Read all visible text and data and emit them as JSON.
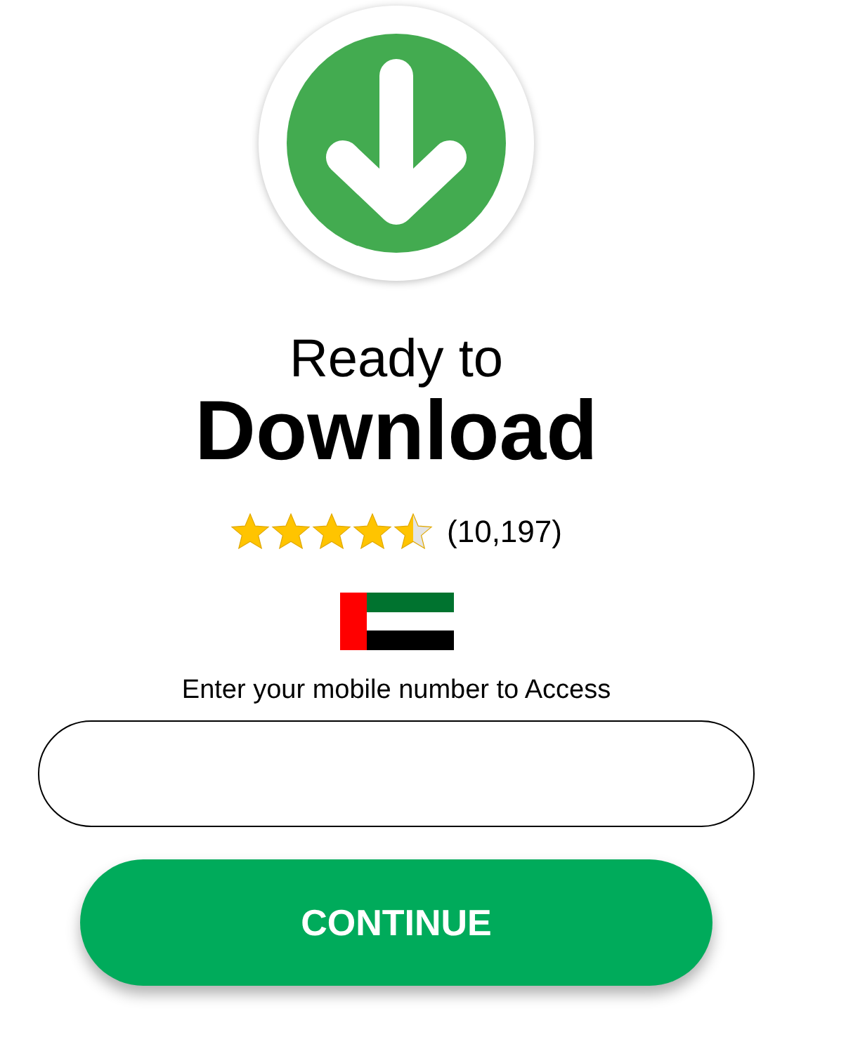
{
  "heading": {
    "line_1": "Ready to",
    "line_2": "Download"
  },
  "rating": {
    "stars": 4.5,
    "count": "(10,197)"
  },
  "prompt": "Enter your mobile number to Access",
  "button": "CONTINUE"
}
